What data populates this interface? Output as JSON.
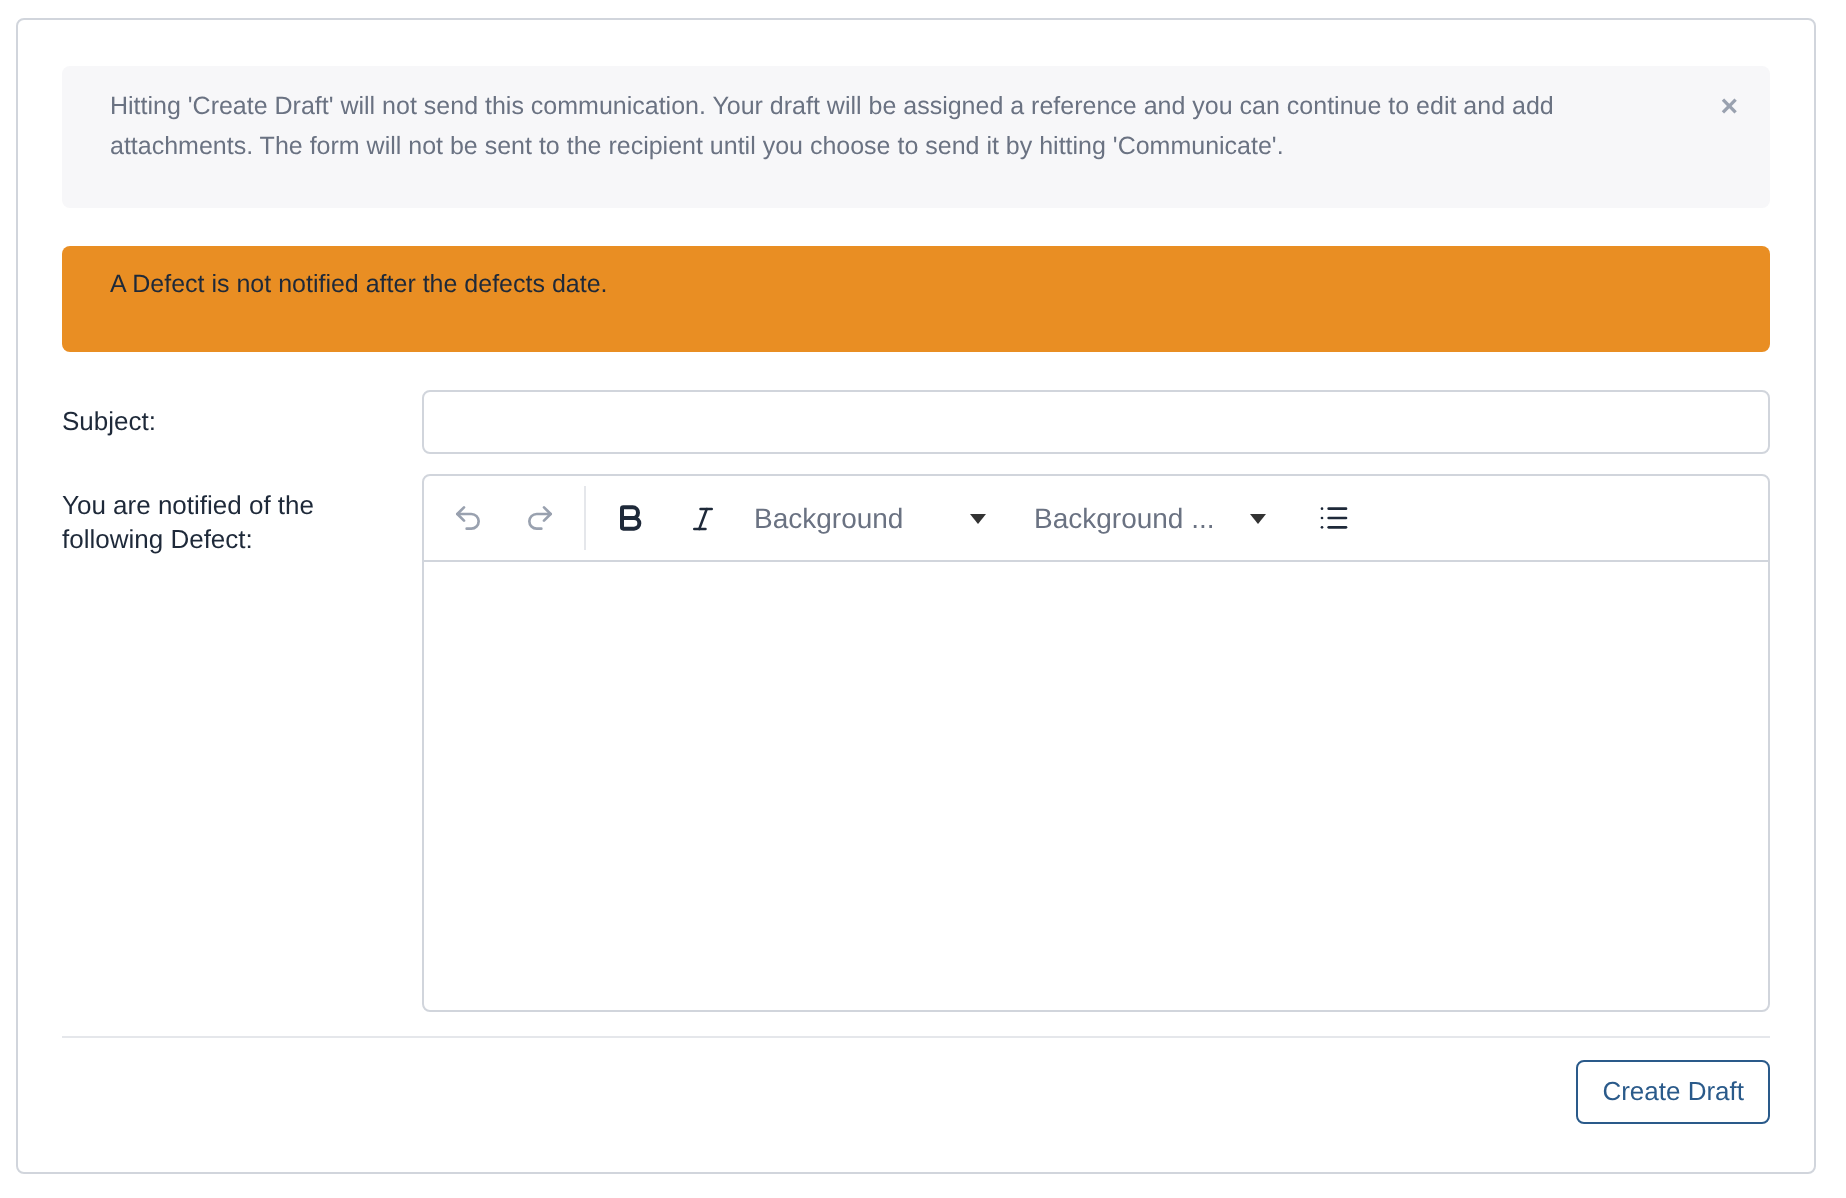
{
  "info_alert": {
    "text": "Hitting 'Create Draft' will not send this communication. Your draft will be assigned a reference and you can continue to edit and add attachments. The form will not be sent to the recipient until you choose to send it by hitting 'Communicate'.",
    "close": "×"
  },
  "warning_alert": {
    "text": "A Defect is not notified after the defects date."
  },
  "subject": {
    "label": "Subject:"
  },
  "body": {
    "label": "You are notified of the following Defect:",
    "toolbar": [
      {
        "kind": "undo"
      },
      {
        "kind": "redo"
      },
      {
        "kind": "divider"
      },
      {
        "kind": "bold"
      },
      {
        "kind": "italic"
      },
      {
        "kind": "dropdown",
        "label": "Background"
      },
      {
        "kind": "dropdown",
        "label": "Background ..."
      },
      {
        "kind": "list"
      }
    ]
  },
  "buttons": [
    {
      "label": "Create Draft"
    }
  ]
}
